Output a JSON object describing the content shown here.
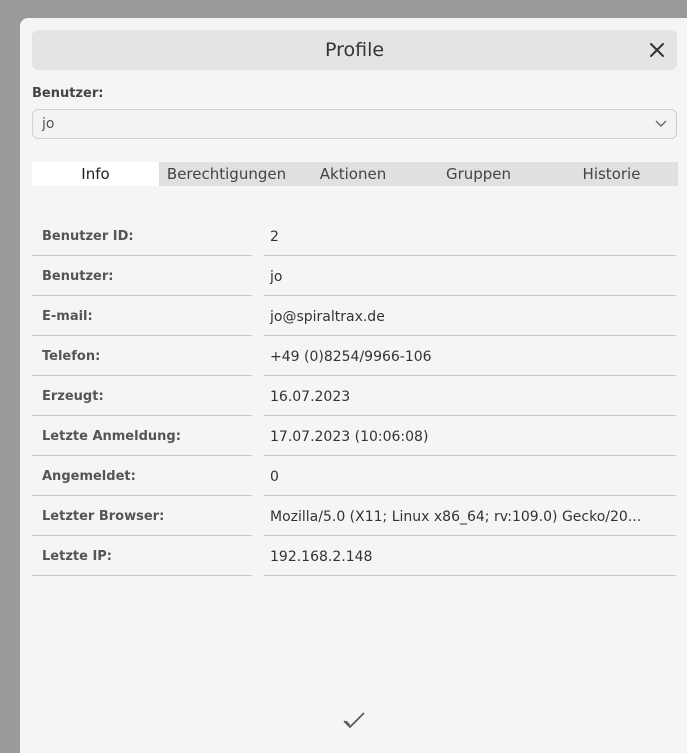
{
  "dialog": {
    "title": "Profile"
  },
  "user_select": {
    "label": "Benutzer:",
    "value": "jo"
  },
  "tabs": [
    {
      "label": "Info",
      "active": true
    },
    {
      "label": "Berechtigungen",
      "active": false
    },
    {
      "label": "Aktionen",
      "active": false
    },
    {
      "label": "Gruppen",
      "active": false
    },
    {
      "label": "Historie",
      "active": false
    }
  ],
  "info_rows": [
    {
      "label": "Benutzer ID:",
      "value": "2"
    },
    {
      "label": "Benutzer:",
      "value": "jo"
    },
    {
      "label": "E-mail:",
      "value": "jo@spiraltrax.de"
    },
    {
      "label": "Telefon:",
      "value": "+49 (0)8254/9966-106"
    },
    {
      "label": "Erzeugt:",
      "value": "16.07.2023"
    },
    {
      "label": "Letzte Anmeldung:",
      "value": "17.07.2023 (10:06:08)"
    },
    {
      "label": "Angemeldet:",
      "value": "0"
    },
    {
      "label": "Letzter Browser:",
      "value": "Mozilla/5.0 (X11; Linux x86_64; rv:109.0) Gecko/20..."
    },
    {
      "label": "Letzte IP:",
      "value": "192.168.2.148"
    }
  ],
  "icons": {
    "close": "close-icon",
    "caret": "chevron-down-icon",
    "confirm": "checkmark-icon"
  }
}
